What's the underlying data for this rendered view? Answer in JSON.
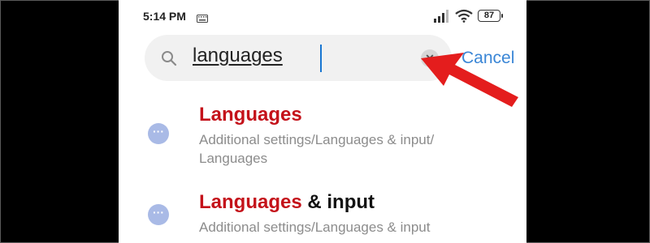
{
  "status_bar": {
    "time": "5:14 PM",
    "battery": "87",
    "icons": [
      "keyboard-icon",
      "signal-icon",
      "wifi-icon",
      "battery-icon"
    ]
  },
  "search": {
    "query": "languages",
    "clear_icon": "close-icon",
    "cancel_label": "Cancel"
  },
  "results": [
    {
      "title_highlight": "Languages",
      "title_rest": "",
      "path": "Additional settings/Languages & input/ Languages",
      "icon": "more-icon"
    },
    {
      "title_highlight": "Languages",
      "title_rest": " & input",
      "path": "Additional settings/Languages & input",
      "icon": "more-icon"
    }
  ],
  "colors": {
    "highlight": "#c4121a",
    "cancel": "#3a86d6",
    "caret": "#1976d2",
    "result_icon": "#a9bae6",
    "annotation_arrow": "#e41d1d"
  }
}
